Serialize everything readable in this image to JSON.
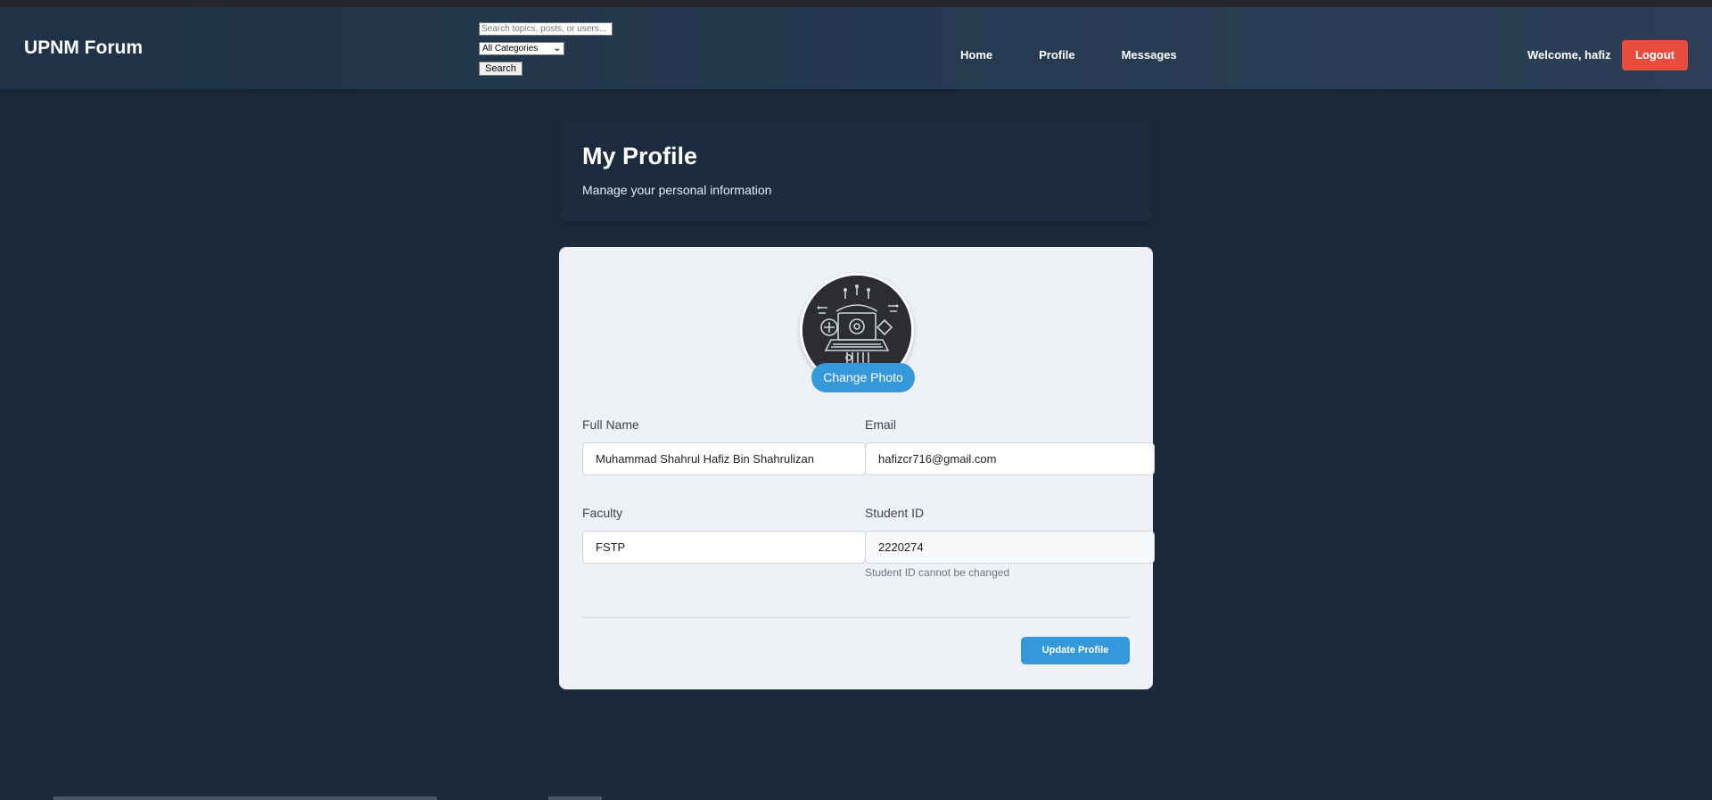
{
  "brand": "UPNM Forum",
  "search": {
    "placeholder": "Search topics, posts, or users...",
    "category_selected": "All Categories",
    "button_label": "Search"
  },
  "nav": {
    "items": [
      {
        "label": "Home"
      },
      {
        "label": "Profile"
      },
      {
        "label": "Messages"
      }
    ],
    "welcome": "Welcome, hafiz",
    "logout_label": "Logout"
  },
  "header": {
    "title": "My Profile",
    "subtitle": "Manage your personal information"
  },
  "profile": {
    "change_photo_label": "Change Photo",
    "full_name_label": "Full Name",
    "full_name_value": "Muhammad Shahrul Hafiz Bin Shahrulizan",
    "email_label": "Email",
    "email_value": "hafizcr716@gmail.com",
    "faculty_label": "Faculty",
    "faculty_value": "FSTP",
    "student_id_label": "Student ID",
    "student_id_value": "2220274",
    "student_id_hint": "Student ID cannot be changed",
    "update_label": "Update Profile"
  },
  "colors": {
    "navbar": "#1f3247",
    "background": "#1b2a3b",
    "logout": "#e74c3c",
    "accent": "#3498db",
    "card": "#eef2f7"
  }
}
